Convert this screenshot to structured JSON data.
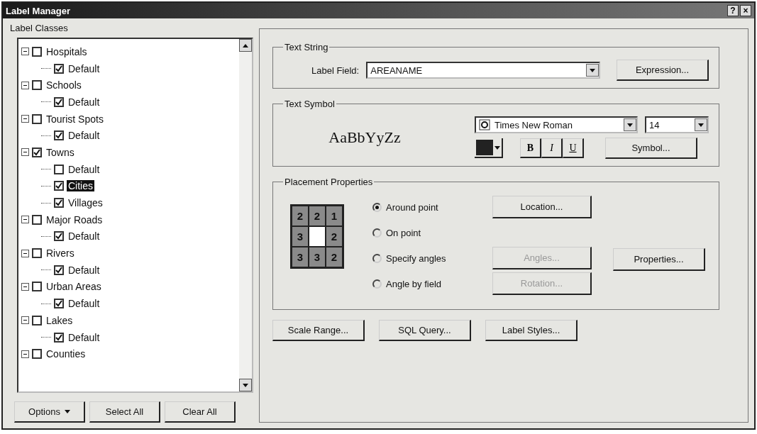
{
  "window": {
    "title": "Label Manager",
    "controls": [
      "?",
      "×"
    ]
  },
  "label_classes": {
    "title": "Label Classes",
    "tree": [
      {
        "label": "Hospitals",
        "checked": false,
        "expanded": true,
        "selected": false,
        "children": [
          {
            "label": "Default",
            "checked": true,
            "selected": false
          }
        ]
      },
      {
        "label": "Schools",
        "checked": false,
        "expanded": true,
        "selected": false,
        "children": [
          {
            "label": "Default",
            "checked": true,
            "selected": false
          }
        ]
      },
      {
        "label": "Tourist Spots",
        "checked": false,
        "expanded": true,
        "selected": false,
        "children": [
          {
            "label": "Default",
            "checked": true,
            "selected": false
          }
        ]
      },
      {
        "label": "Towns",
        "checked": true,
        "expanded": true,
        "selected": false,
        "children": [
          {
            "label": "Default",
            "checked": false,
            "selected": false
          },
          {
            "label": "Cities",
            "checked": true,
            "selected": true
          },
          {
            "label": "Villages",
            "checked": true,
            "selected": false
          }
        ]
      },
      {
        "label": "Major Roads",
        "checked": false,
        "expanded": true,
        "selected": false,
        "children": [
          {
            "label": "Default",
            "checked": true,
            "selected": false
          }
        ]
      },
      {
        "label": "Rivers",
        "checked": false,
        "expanded": true,
        "selected": false,
        "children": [
          {
            "label": "Default",
            "checked": true,
            "selected": false
          }
        ]
      },
      {
        "label": "Urban Areas",
        "checked": false,
        "expanded": true,
        "selected": false,
        "children": [
          {
            "label": "Default",
            "checked": true,
            "selected": false
          }
        ]
      },
      {
        "label": "Lakes",
        "checked": false,
        "expanded": true,
        "selected": false,
        "children": [
          {
            "label": "Default",
            "checked": true,
            "selected": false
          }
        ]
      },
      {
        "label": "Counties",
        "checked": false,
        "expanded": true,
        "selected": false
      }
    ],
    "buttons": [
      {
        "label": "Options",
        "kind": "menu"
      },
      {
        "label": "Select All",
        "kind": "plain"
      },
      {
        "label": "Clear All",
        "kind": "plain"
      }
    ]
  },
  "text_string": {
    "title": "Text String",
    "label_field": {
      "label": "Label Field:",
      "value": "AREANAME"
    },
    "expression_button": "Expression..."
  },
  "text_symbol": {
    "title": "Text Symbol",
    "preview": "AaBbYyZz",
    "font": "Times New Roman",
    "size": "14",
    "color": "#222222",
    "styles": [
      {
        "label": "B",
        "kind": "bold",
        "on": false
      },
      {
        "label": "I",
        "kind": "italic",
        "on": false
      },
      {
        "label": "U",
        "kind": "underline",
        "on": false
      }
    ],
    "symbol_button": "Symbol..."
  },
  "placement": {
    "title": "Placement Properties",
    "grid": [
      {
        "kind": "priority",
        "text": "2"
      },
      {
        "kind": "priority",
        "text": "2"
      },
      {
        "kind": "priority",
        "text": "1"
      },
      {
        "kind": "priority",
        "text": "3"
      },
      {
        "kind": "point"
      },
      {
        "kind": "priority",
        "text": "2"
      },
      {
        "kind": "priority",
        "text": "3"
      },
      {
        "kind": "priority",
        "text": "3"
      },
      {
        "kind": "priority",
        "text": "2"
      }
    ],
    "options": [
      {
        "label": "Around point",
        "selected": true,
        "button": {
          "label": "Location...",
          "disabled": false
        }
      },
      {
        "label": "On point",
        "selected": false
      },
      {
        "label": "Specify angles",
        "selected": false,
        "button": {
          "label": "Angles...",
          "disabled": true
        }
      },
      {
        "label": "Angle by field",
        "selected": false,
        "button": {
          "label": "Rotation...",
          "disabled": true
        }
      }
    ],
    "properties_button": "Properties..."
  },
  "bottom_buttons": [
    "Scale Range...",
    "SQL Query...",
    "Label Styles..."
  ]
}
